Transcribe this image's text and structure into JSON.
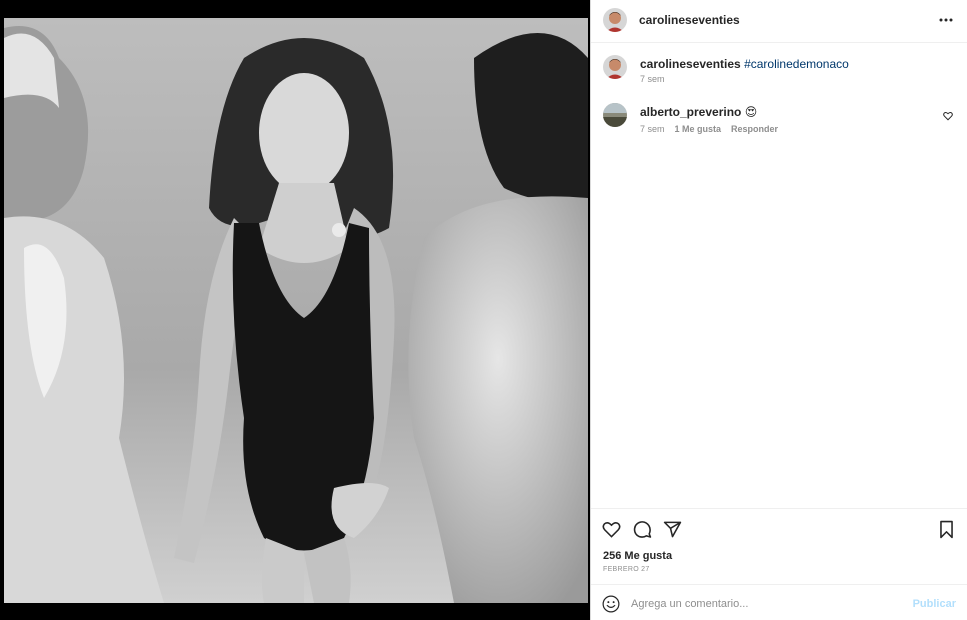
{
  "post": {
    "author": "carolineseventies",
    "more_icon": "more-horizontal-icon"
  },
  "caption": {
    "author": "carolineseventies",
    "hashtag": "#carolinedemonaco",
    "time": "7 sem"
  },
  "comments": [
    {
      "author": "alberto_preverino",
      "emoji": "😍",
      "time": "7 sem",
      "likes": "1 Me gusta",
      "reply": "Responder"
    }
  ],
  "actions": {
    "like_icon": "heart-icon",
    "comment_icon": "comment-icon",
    "share_icon": "send-icon",
    "save_icon": "bookmark-icon"
  },
  "likes_text": "256 Me gusta",
  "date_text": "FEBRERO 27",
  "add_comment": {
    "placeholder": "Agrega un comentario...",
    "publish_label": "Publicar"
  },
  "colors": {
    "hashtag": "#00376b",
    "publish_disabled": "#b2dffc",
    "muted": "#8e8e8e"
  }
}
